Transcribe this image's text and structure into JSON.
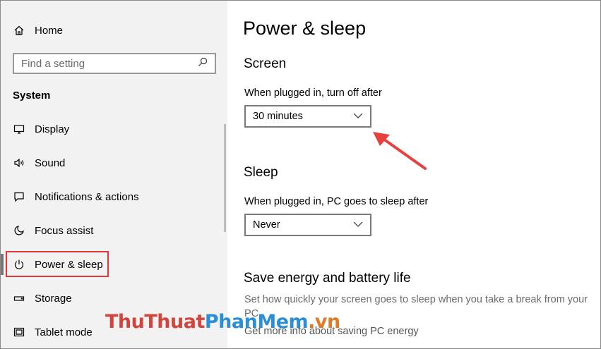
{
  "sidebar": {
    "home_label": "Home",
    "search_placeholder": "Find a setting",
    "section_title": "System",
    "items": [
      {
        "label": "Display",
        "icon": "monitor-icon"
      },
      {
        "label": "Sound",
        "icon": "speaker-icon"
      },
      {
        "label": "Notifications & actions",
        "icon": "message-icon"
      },
      {
        "label": "Focus assist",
        "icon": "moon-icon"
      },
      {
        "label": "Power & sleep",
        "icon": "power-icon",
        "selected": true
      },
      {
        "label": "Storage",
        "icon": "storage-icon"
      },
      {
        "label": "Tablet mode",
        "icon": "tablet-icon"
      }
    ]
  },
  "main": {
    "title": "Power & sleep",
    "screen": {
      "heading": "Screen",
      "label": "When plugged in, turn off after",
      "value": "30 minutes"
    },
    "sleep": {
      "heading": "Sleep",
      "label": "When plugged in, PC goes to sleep after",
      "value": "Never"
    },
    "energy": {
      "heading": "Save energy and battery life",
      "description": "Set how quickly your screen goes to sleep when you take a break from your PC.",
      "link": "Get more info about saving PC energy"
    }
  },
  "watermark": {
    "part1": "Thu",
    "part2": "Thuat",
    "part3": "PhanMem",
    "part4": ".vn"
  },
  "colors": {
    "highlight": "#e0363c",
    "arrow": "#e8403f",
    "sidebar_bg": "#f2f2f2"
  }
}
